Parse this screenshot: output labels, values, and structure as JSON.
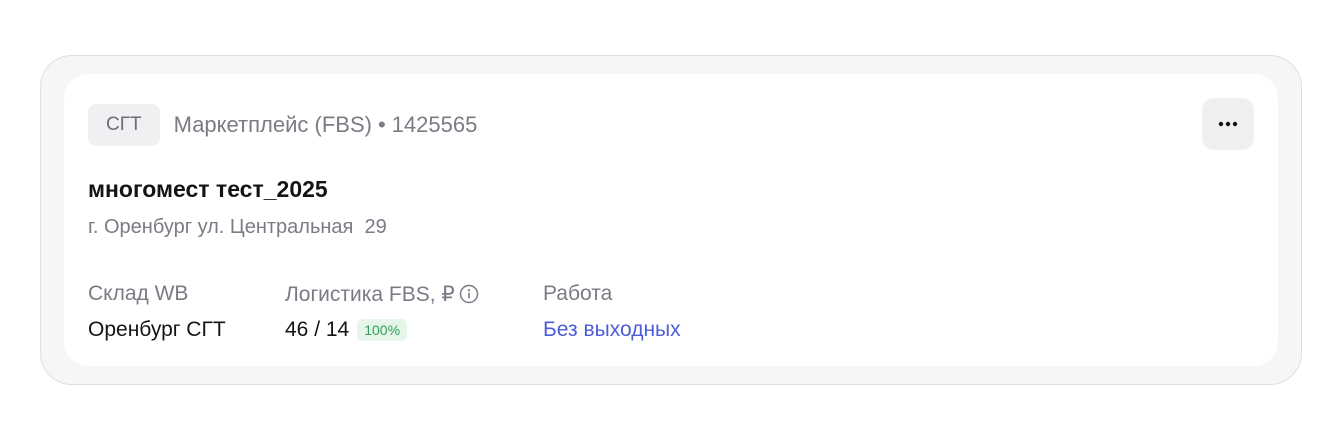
{
  "card": {
    "tag": "СГТ",
    "type": "Маркетплейс (FBS)",
    "separator": "•",
    "id": "1425565",
    "title": "многомест тест_2025",
    "address": "г. Оренбург ул. Центральная  29",
    "menu_icon": "more-horizontal-icon",
    "columns": {
      "warehouse": {
        "label": "Склад WB",
        "value": "Оренбург СГТ"
      },
      "logistics": {
        "label": "Логистика FBS, ₽",
        "info_icon": "info-icon",
        "value": "46 / 14",
        "badge": "100%"
      },
      "work": {
        "label": "Работа",
        "value": "Без выходных"
      }
    }
  },
  "colors": {
    "accent_link": "#4b5ed7",
    "badge_bg": "#e6f5ea",
    "badge_text": "#2f9e56"
  }
}
